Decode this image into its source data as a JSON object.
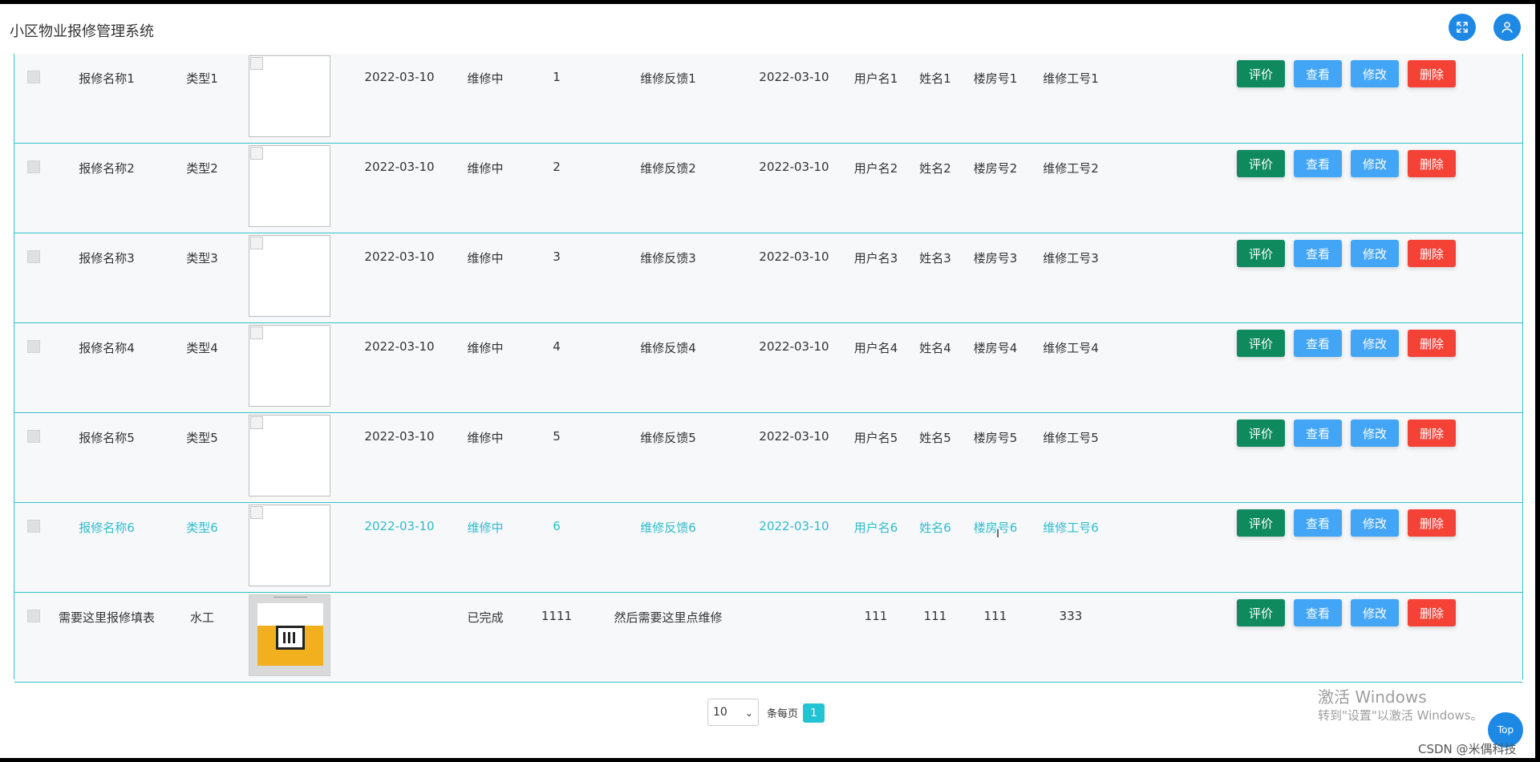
{
  "header": {
    "title": "小区物业报修管理系统",
    "fullscreen_icon": "expand-icon",
    "user_icon": "user-icon"
  },
  "actions": {
    "eval": "评价",
    "view": "查看",
    "edit": "修改",
    "del": "删除"
  },
  "rows": [
    {
      "name": "报修名称1",
      "type": "类型1",
      "date": "2022-03-10",
      "status": "维修中",
      "num": "1",
      "feedback": "维修反馈1",
      "date2": "2022-03-10",
      "user": "用户名1",
      "real": "姓名1",
      "building": "楼房号1",
      "worker": "维修工号1"
    },
    {
      "name": "报修名称2",
      "type": "类型2",
      "date": "2022-03-10",
      "status": "维修中",
      "num": "2",
      "feedback": "维修反馈2",
      "date2": "2022-03-10",
      "user": "用户名2",
      "real": "姓名2",
      "building": "楼房号2",
      "worker": "维修工号2"
    },
    {
      "name": "报修名称3",
      "type": "类型3",
      "date": "2022-03-10",
      "status": "维修中",
      "num": "3",
      "feedback": "维修反馈3",
      "date2": "2022-03-10",
      "user": "用户名3",
      "real": "姓名3",
      "building": "楼房号3",
      "worker": "维修工号3"
    },
    {
      "name": "报修名称4",
      "type": "类型4",
      "date": "2022-03-10",
      "status": "维修中",
      "num": "4",
      "feedback": "维修反馈4",
      "date2": "2022-03-10",
      "user": "用户名4",
      "real": "姓名4",
      "building": "楼房号4",
      "worker": "维修工号4"
    },
    {
      "name": "报修名称5",
      "type": "类型5",
      "date": "2022-03-10",
      "status": "维修中",
      "num": "5",
      "feedback": "维修反馈5",
      "date2": "2022-03-10",
      "user": "用户名5",
      "real": "姓名5",
      "building": "楼房号5",
      "worker": "维修工号5"
    },
    {
      "name": "报修名称6",
      "type": "类型6",
      "date": "2022-03-10",
      "status": "维修中",
      "num": "6",
      "feedback": "维修反馈6",
      "date2": "2022-03-10",
      "user": "用户名6",
      "real": "姓名6",
      "building": "楼房号6",
      "worker": "维修工号6"
    },
    {
      "name": "需要这里报修填表",
      "type": "水工",
      "date": "",
      "status": "已完成",
      "num": "1111",
      "feedback": "然后需要这里点维修",
      "date2": "",
      "user": "111",
      "real": "111",
      "building": "111",
      "worker": "333"
    }
  ],
  "pager": {
    "page_size": "10",
    "per_page_label": "条每页",
    "current_page": "1"
  },
  "watermark": {
    "line1": "激活 Windows",
    "line2": "转到\"设置\"以激活 Windows。"
  },
  "top_button": "Top",
  "csdn": "CSDN @米偶科技",
  "colors": {
    "teal": "#31c3c6",
    "highlight_text": "#2fbccb",
    "eval": "#0f8a5f",
    "view": "#42a5f5",
    "delete": "#f44336"
  }
}
